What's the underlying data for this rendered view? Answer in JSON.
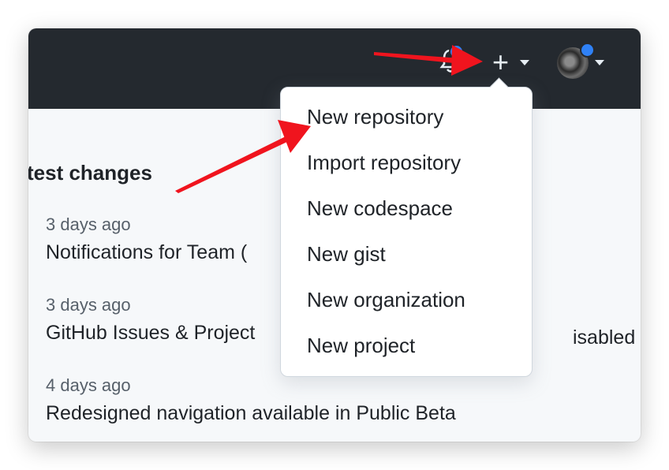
{
  "header": {
    "icons": [
      "notification-bell-icon",
      "plus-icon",
      "chevron-down-icon",
      "avatar"
    ],
    "plus_label": "+",
    "colors": {
      "background": "#24292f",
      "notification_dot": "#2f81f7"
    }
  },
  "section": {
    "title": "test changes"
  },
  "changes": [
    {
      "time": "3 days ago",
      "title": "Notifications for Team (",
      "title_tail": "isabled"
    },
    {
      "time": "3 days ago",
      "title": "GitHub Issues & Project"
    },
    {
      "time": "4 days ago",
      "title": "Redesigned navigation available in Public Beta"
    }
  ],
  "menu": {
    "items": [
      {
        "label": "New repository"
      },
      {
        "label": "Import repository"
      },
      {
        "label": "New codespace"
      },
      {
        "label": "New gist"
      },
      {
        "label": "New organization"
      },
      {
        "label": "New project"
      }
    ]
  },
  "annotations": {
    "arrow_color": "#f0141e"
  }
}
